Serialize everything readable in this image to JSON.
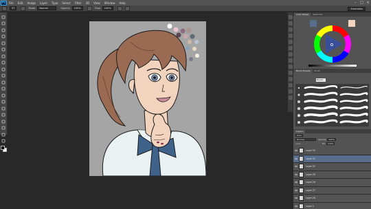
{
  "app": {
    "logo": "Ps"
  },
  "menu": [
    "File",
    "Edit",
    "Image",
    "Layer",
    "Type",
    "Select",
    "Filter",
    "3D",
    "View",
    "Window",
    "Help"
  ],
  "options": {
    "brush_size": "37",
    "mode_label": "Mode:",
    "mode_value": "Normal",
    "opacity_label": "Opacity:",
    "opacity_value": "100%",
    "flow_label": "Flow:",
    "flow_value": "100%",
    "workspace": "Essentials"
  },
  "colors": {
    "foreground": "#000000",
    "background": "#ffffff",
    "canvas_bg": "#a5a5a5",
    "selection": "#576d8b"
  },
  "panels": {
    "color_tabs": [
      "Color Wheel",
      "Swatches"
    ],
    "brush_tabs": [
      "Brush Presets",
      "Brush"
    ],
    "brush_search": "Brush",
    "layer_tabs": [
      "Layers"
    ],
    "kind_label": "Kind",
    "blend_mode": "Normal",
    "opacity_label": "Opacity:",
    "opacity_value": "100%",
    "lock_label": "Lock:",
    "fill_label": "Fill:",
    "fill_value": "100%"
  },
  "layers": [
    {
      "name": "Layer 30",
      "selected": false
    },
    {
      "name": "Layer 31",
      "selected": true
    },
    {
      "name": "Layer 32",
      "selected": false
    },
    {
      "name": "Layer 29",
      "selected": false
    },
    {
      "name": "Layer 28",
      "selected": false
    },
    {
      "name": "Layer 27",
      "selected": false
    },
    {
      "name": "Layer 26",
      "selected": false
    },
    {
      "name": "Layer 3",
      "selected": false
    }
  ],
  "icons": {
    "tools": [
      "move-icon",
      "marquee-icon",
      "lasso-icon",
      "quick-select-icon",
      "crop-icon",
      "eyedropper-icon",
      "healing-icon",
      "brush-icon",
      "stamp-icon",
      "history-brush-icon",
      "eraser-icon",
      "gradient-icon",
      "blur-icon",
      "dodge-icon",
      "pen-icon",
      "type-icon",
      "path-select-icon",
      "shape-icon",
      "hand-icon",
      "zoom-icon"
    ]
  }
}
